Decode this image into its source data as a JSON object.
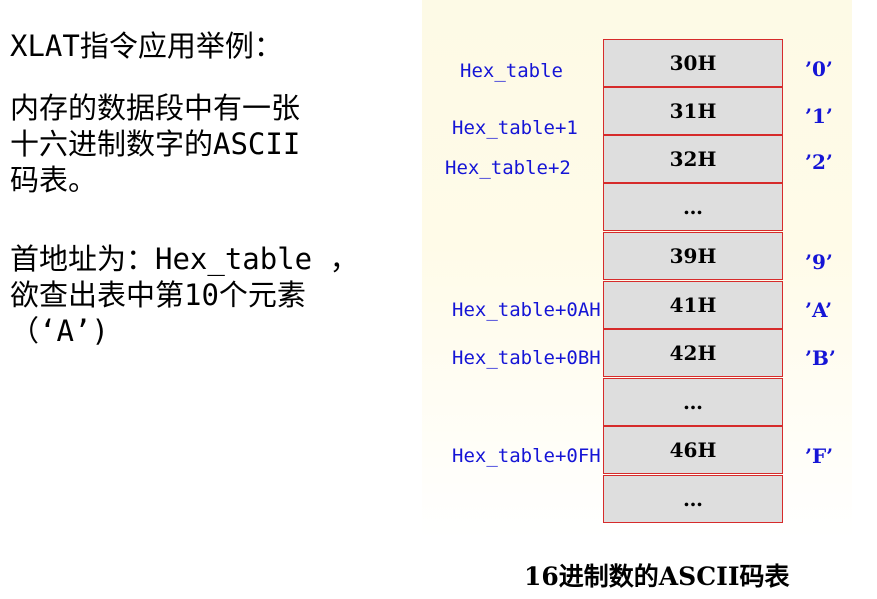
{
  "left": {
    "title": "XLAT指令应用举例：",
    "description": "内存的数据段中有一张\n十六进制数字的ASCII\n码表。",
    "base_info": "首地址为：Hex_table ，\n欲查出表中第10个元素\n（‘A’)"
  },
  "table": {
    "rows": [
      {
        "value": "30H",
        "address": "Hex_table",
        "char": "’0’"
      },
      {
        "value": "31H",
        "address": "Hex_table+1",
        "char": "’1’"
      },
      {
        "value": "32H",
        "address": "Hex_table+2",
        "char": "’2’"
      },
      {
        "value": "…",
        "address": "",
        "char": ""
      },
      {
        "value": "39H",
        "address": "",
        "char": "’9’"
      },
      {
        "value": "41H",
        "address": "Hex_table+0AH",
        "char": "’A’"
      },
      {
        "value": "42H",
        "address": "Hex_table+0BH",
        "char": "’B’"
      },
      {
        "value": "…",
        "address": "",
        "char": ""
      },
      {
        "value": "46H",
        "address": "Hex_table+0FH",
        "char": "’F’"
      },
      {
        "value": "…",
        "address": "",
        "char": ""
      }
    ],
    "caption": "16进制数的ASCII码表"
  },
  "colors": {
    "cell_fill": "#dedede",
    "cell_border": "#d62b2b",
    "label_blue": "#1515d6"
  }
}
